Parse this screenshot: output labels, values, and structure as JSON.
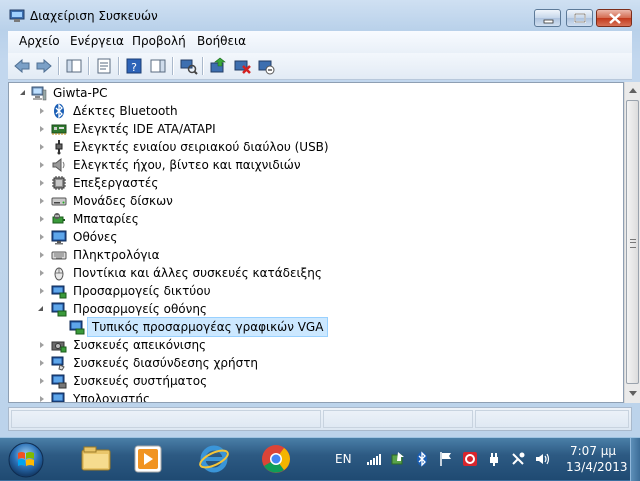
{
  "window": {
    "title": "Διαχείριση Συσκευών"
  },
  "menu": [
    "Αρχείο",
    "Ενέργεια",
    "Προβολή",
    "Βοήθεια"
  ],
  "tree": {
    "root": "Giwta-PC",
    "items": [
      {
        "label": "Δέκτες Bluetooth",
        "icon": "bluetooth-icon",
        "expanded": false
      },
      {
        "label": "Ελεγκτές IDE ATA/ATAPI",
        "icon": "ide-controller-icon",
        "expanded": false
      },
      {
        "label": "Ελεγκτές ενιαίου σειριακού διαύλου (USB)",
        "icon": "usb-icon",
        "expanded": false
      },
      {
        "label": "Ελεγκτές ήχου, βίντεο και παιχνιδιών",
        "icon": "speaker-icon",
        "expanded": false
      },
      {
        "label": "Επεξεργαστές",
        "icon": "processor-icon",
        "expanded": false
      },
      {
        "label": "Μονάδες δίσκων",
        "icon": "disk-drive-icon",
        "expanded": false
      },
      {
        "label": "Μπαταρίες",
        "icon": "battery-icon",
        "expanded": false
      },
      {
        "label": "Οθόνες",
        "icon": "monitor-icon",
        "expanded": false
      },
      {
        "label": "Πληκτρολόγια",
        "icon": "keyboard-icon",
        "expanded": false
      },
      {
        "label": "Ποντίκια και άλλες συσκευές κατάδειξης",
        "icon": "mouse-icon",
        "expanded": false
      },
      {
        "label": "Προσαρμογείς δικτύου",
        "icon": "network-adapter-icon",
        "expanded": false
      },
      {
        "label": "Προσαρμογείς οθόνης",
        "icon": "display-adapter-icon",
        "expanded": true
      },
      {
        "label": "Τυπικός προσαρμογέας γραφικών VGA",
        "icon": "display-adapter-icon",
        "child": true,
        "selected": true
      },
      {
        "label": "Συσκευές απεικόνισης",
        "icon": "camera-icon",
        "expanded": false
      },
      {
        "label": "Συσκευές διασύνδεσης χρήστη",
        "icon": "hid-icon",
        "expanded": false
      },
      {
        "label": "Συσκευές συστήματος",
        "icon": "system-device-icon",
        "expanded": false
      },
      {
        "label": "Υπολογιστής",
        "icon": "computer-icon",
        "expanded": false
      }
    ]
  },
  "taskbar": {
    "language": "EN",
    "time": "7:07 μμ",
    "date": "13/4/2013"
  },
  "colors": {
    "selection_bg": "#cce8ff",
    "taskbar": "#2d5a83"
  }
}
